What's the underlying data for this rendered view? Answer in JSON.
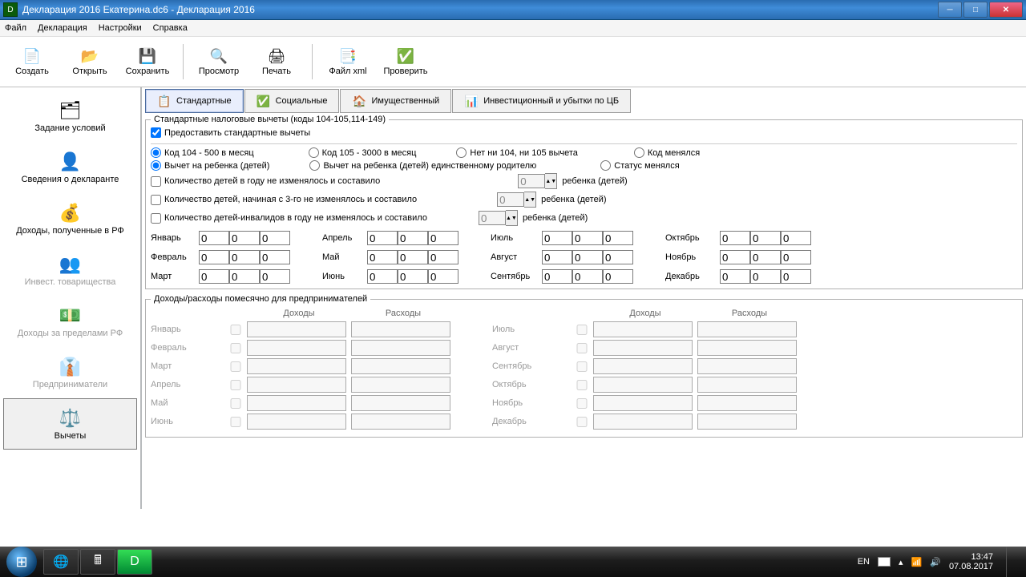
{
  "window": {
    "title": "Декларация 2016 Екатерина.dc6 - Декларация 2016"
  },
  "menu": {
    "file": "Файл",
    "decl": "Декларация",
    "settings": "Настройки",
    "help": "Справка"
  },
  "toolbar": {
    "create": "Создать",
    "open": "Открыть",
    "save": "Сохранить",
    "preview": "Просмотр",
    "print": "Печать",
    "xml": "Файл xml",
    "check": "Проверить"
  },
  "sidebar": {
    "items": [
      {
        "label": "Задание условий"
      },
      {
        "label": "Сведения о декларанте"
      },
      {
        "label": "Доходы, полученные в РФ"
      },
      {
        "label": "Инвест. товарищества"
      },
      {
        "label": "Доходы за пределами РФ"
      },
      {
        "label": "Предприниматели"
      },
      {
        "label": "Вычеты"
      }
    ]
  },
  "tabs": {
    "standard": "Стандартные",
    "social": "Социальные",
    "property": "Имущественный",
    "invest": "Инвестиционный и убытки по ЦБ"
  },
  "group": {
    "legend": "Стандартные налоговые вычеты (коды 104-105,114-149)",
    "provide": "Предоставить стандартные вычеты",
    "code104": "Код 104 - 500 в месяц",
    "code105": "Код 105 - 3000 в месяц",
    "no104105": "Нет ни 104, ни 105 вычета",
    "codeChanged": "Код менялся",
    "childDeduct": "Вычет на ребенка (детей)",
    "childSingle": "Вычет на ребенка (детей) единственному родителю",
    "statusChanged": "Статус менялся",
    "count1": "Количество детей в году не изменялось и составило",
    "count2": "Количество детей, начиная с 3-го не изменялось и составило",
    "count3": "Количество детей-инвалидов в году не изменялось и составило",
    "childUnit": "ребенка (детей)",
    "spinVal": "0"
  },
  "months": {
    "jan": "Январь",
    "feb": "Февраль",
    "mar": "Март",
    "apr": "Апрель",
    "may": "Май",
    "jun": "Июнь",
    "jul": "Июль",
    "aug": "Август",
    "sep": "Сентябрь",
    "oct": "Октябрь",
    "nov": "Ноябрь",
    "dec": "Декабрь",
    "val": "0"
  },
  "biz": {
    "legend": "Доходы/расходы помесячно для предпринимателей",
    "income": "Доходы",
    "expense": "Расходы"
  },
  "tray": {
    "lang": "EN",
    "time": "13:47",
    "date": "07.08.2017"
  }
}
